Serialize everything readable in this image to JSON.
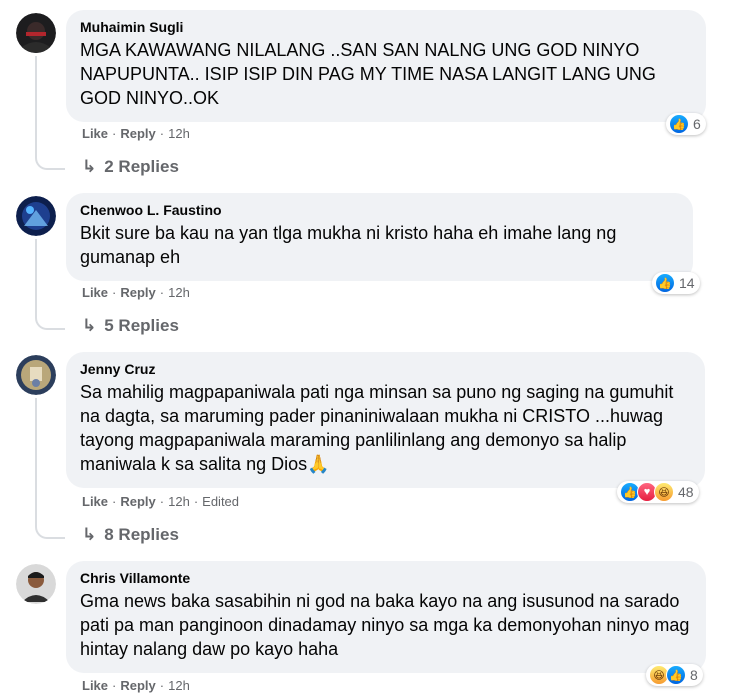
{
  "comments": [
    {
      "author": "Muhaimin Sugli",
      "text": "MGA KAWAWANG NILALANG ..SAN SAN NALNG UNG GOD NINYO NAPUPUNTA.. ISIP ISIP DIN PAG MY TIME NASA LANGIT LANG UNG GOD NINYO..OK",
      "like": "Like",
      "reply": "Reply",
      "time": "12h",
      "reaction_count": "6",
      "replies": "2 Replies"
    },
    {
      "author": "Chenwoo L. Faustino",
      "text": "Bkit sure ba kau na yan tlga mukha ni kristo haha eh imahe lang ng gumanap eh",
      "like": "Like",
      "reply": "Reply",
      "time": "12h",
      "reaction_count": "14",
      "replies": "5 Replies"
    },
    {
      "author": "Jenny Cruz",
      "text": "Sa mahilig magpapaniwala pati nga minsan sa puno ng saging na gumuhit na dagta, sa maruming pader pinaniniwalaan mukha ni CRISTO ...huwag tayong magpapaniwala maraming panlilinlang ang demonyo sa halip maniwala k sa salita ng Dios🙏",
      "like": "Like",
      "reply": "Reply",
      "time": "12h",
      "edited": "Edited",
      "reaction_count": "48",
      "replies": "8 Replies"
    },
    {
      "author": "Chris Villamonte",
      "text": "Gma news baka sasabihin ni god na baka kayo na ang isusunod na sarado pati pa man panginoon dinadamay ninyo sa mga ka demonyohan ninyo mag hintay nalang daw po kayo haha",
      "like": "Like",
      "reply": "Reply",
      "time": "12h",
      "reaction_count": "8"
    }
  ],
  "icons": {
    "reply_arrow": "↳",
    "like": "like-icon",
    "love": "love-icon",
    "haha": "haha-icon"
  },
  "colors": {
    "bubble": "#f0f2f5",
    "meta": "#65676b",
    "like_blue": "#1877f2"
  }
}
